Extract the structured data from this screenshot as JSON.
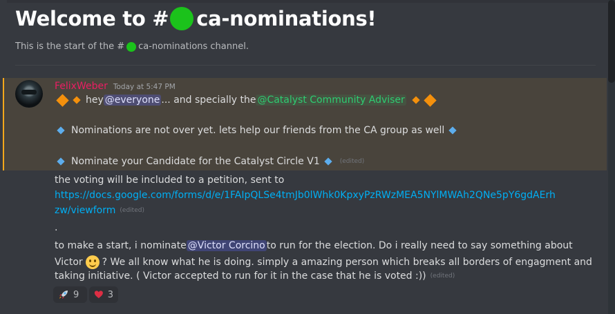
{
  "channel": {
    "welcome_prefix": "Welcome to #",
    "welcome_suffix": "ca-nominations!",
    "start_prefix": "This is the start of the #",
    "start_suffix": "ca-nominations channel."
  },
  "message": {
    "username": "FelixWeber",
    "timestamp": "Today at 5:47 PM",
    "line1": {
      "text_a": "hey ",
      "mention_everyone": "@everyone",
      "text_b": "... and specially the ",
      "role_mention": "@Catalyst Community Adviser"
    },
    "line2": "Nominations are not over yet. lets help our friends from the CA group as well",
    "line3": "Nominate your Candidate for the Catalyst Circle V1",
    "line3_edited": "(edited)"
  },
  "followup": {
    "petition_text": "the voting will be included to a petition, sent to",
    "link_part1": "https://docs.google.com/forms/d/e/1FAIpQLSe4tmJb0lWhk0KpxyPzRWzMEA5NYlMWAh2QNe5pY6gdAErh",
    "link_part2": "zw/viewform",
    "link_edited": "(edited)",
    "dot": ".",
    "nominate_a": "to make a start, i nominate ",
    "mention_victor": "@Victor Corcino",
    "nominate_b": " to run for the election. Do i really need to say something about",
    "victor_a": "Victor ",
    "victor_b": " ? We all know what he is doing. simply a amazing person which breaks all borders of engagment and",
    "initiative": "taking initiative. ( Victor accepted to run for it in the case that he is voted :))",
    "initiative_edited": "(edited)"
  },
  "reactions": [
    {
      "emoji": "rocket",
      "count": "9"
    },
    {
      "emoji": "heart",
      "count": "3"
    }
  ]
}
